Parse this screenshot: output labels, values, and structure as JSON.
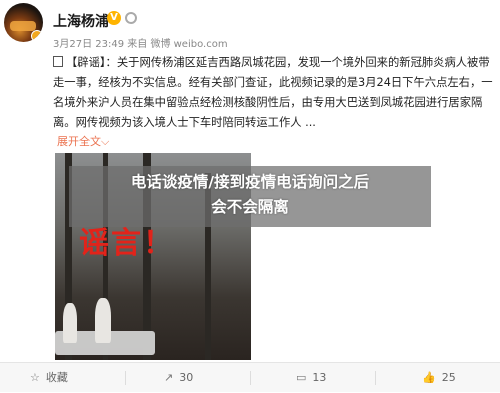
{
  "author": {
    "name": "上海杨浦"
  },
  "post": {
    "meta": "3月27日 23:49 来自 微博 weibo.com",
    "tag": "【辟谣】",
    "body": "：关于网传杨浦区延吉西路凤城花园，发现一个境外回来的新冠肺炎病人被带走一事，经核为不实信息。经有关部门查证，此视频记录的是3月24日下午六点左右，一名境外来沪人员在集中留验点经检测核酸阴性后，由专用大巴送到凤城花园进行居家隔离。网传视频为该入境人士下车时陪同转运工作人 ...",
    "expand_label": "展开全文",
    "expand_chevron": "⌵"
  },
  "image": {
    "overlay_text": "谣言！",
    "icon": "photo-night-bus-scene"
  },
  "headline": {
    "line1": "电话谈疫情/接到疫情电话询问之后",
    "line2": "会不会隔离"
  },
  "actions": {
    "favorite": {
      "icon": "star-icon",
      "glyph": "☆",
      "label": "收藏"
    },
    "share": {
      "icon": "share-icon",
      "glyph": "↗",
      "label": "30"
    },
    "comment": {
      "icon": "comment-icon",
      "glyph": "▭",
      "label": "13"
    },
    "like": {
      "icon": "thumb-up-icon",
      "glyph": "👍",
      "label": "25"
    }
  },
  "colors": {
    "accent": "#eb7350",
    "rumor_red": "#e2231a",
    "badge_gold": "#ffb400"
  }
}
